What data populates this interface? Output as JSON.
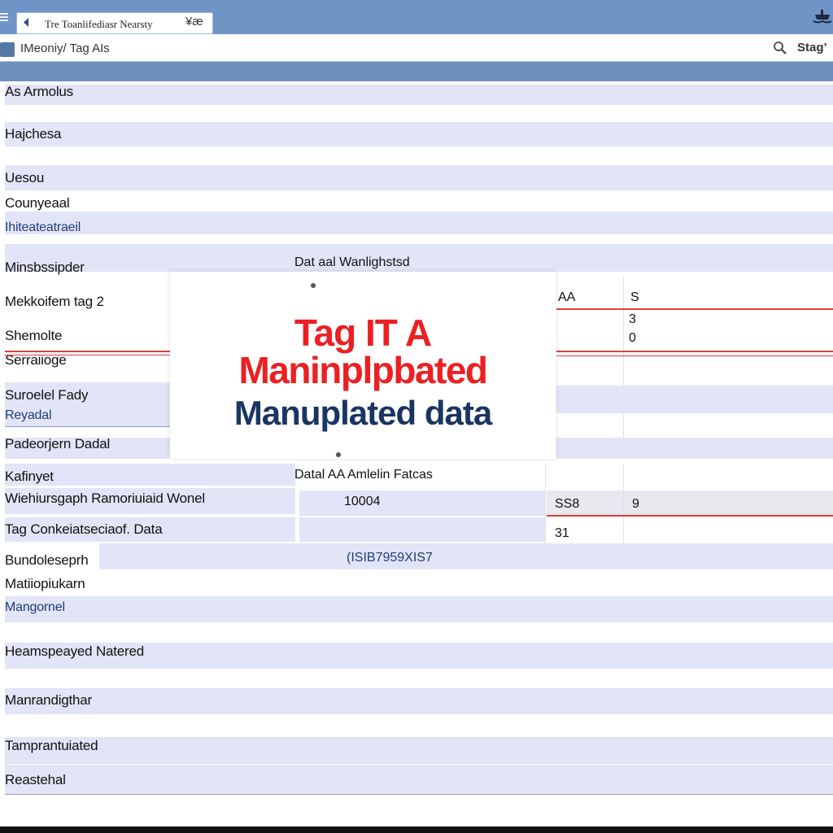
{
  "window": {
    "tab_title": "Tre Toanlifediasr Nearsty",
    "tab_tag": "¥æ"
  },
  "toolbar": {
    "title": "IMeoniy/ Tag AIs",
    "stage_label": "Stag’"
  },
  "rows": [
    "As Armolus",
    "Hajchesa",
    "Uesou",
    "Counyeaal",
    "Ihiteateatraeil",
    "Minsbssipder",
    "Mekkoifem tag 2",
    "Shemolte",
    "Serraiioge",
    "Suroelel Fady",
    "Reyadal",
    "Padeorjern Dadal",
    "Kafinyet",
    "Wiehiursgaph Ramoriuiaid Wonel",
    "Tag Conkeiatseciaof. Data",
    "Bundoleseprh",
    "Matiiopiukarn",
    "Mangornel",
    "Heamspeayed Natered",
    "Manrandigthar",
    "Tamprantuiated",
    "Reastehal"
  ],
  "table_upper": {
    "header": "Dat aal Wanlighstsd",
    "col_a": "AA",
    "col_s": "S",
    "values": [
      "3",
      "0"
    ]
  },
  "table_lower": {
    "header": "Datal AA Amlelin Fatcas",
    "value_main": "10004",
    "value_code": "SS8",
    "value_extra": "9",
    "value_31": "31",
    "serial": "(ISIB7959XIS7"
  },
  "overlay": {
    "line1": "Tag IT A",
    "line2": "Maninplpbated",
    "line3": "Manuplated data"
  },
  "colors": {
    "titlebar": "#6f95c7",
    "band": "#e2e4f7",
    "red_accent": "#ec2022",
    "navy_accent": "#1a3563"
  }
}
